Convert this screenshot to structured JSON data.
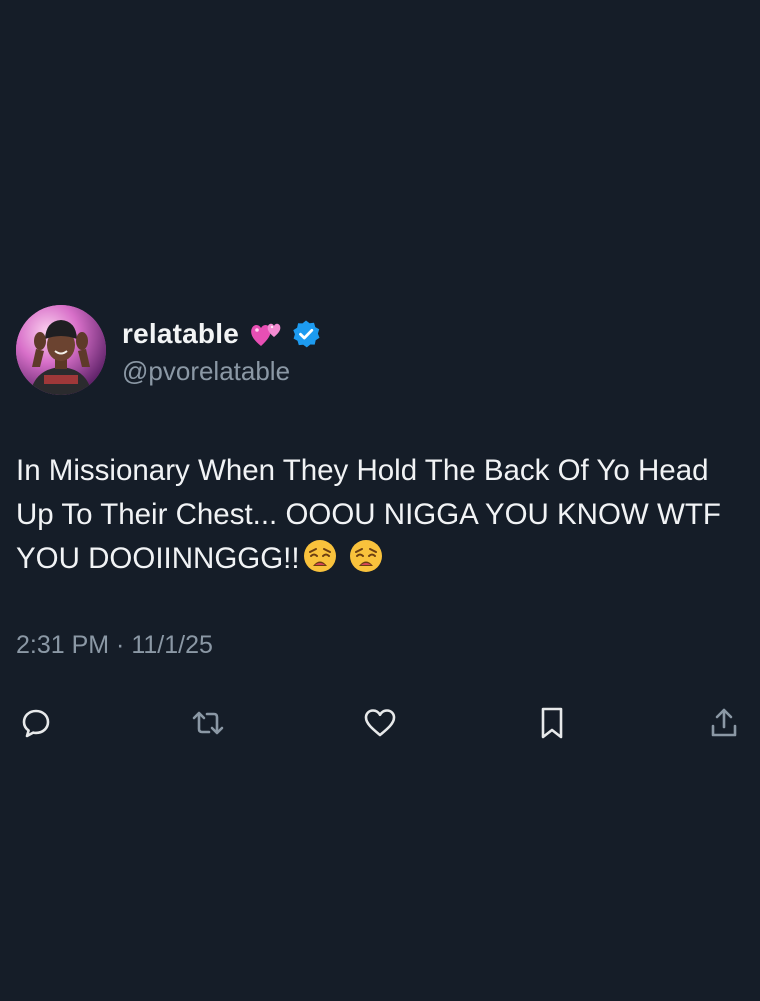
{
  "tweet": {
    "display_name": "relatable",
    "handle": "@pvorelatable",
    "name_emoji": "revolving-hearts-emoji",
    "verified_badge": "blue-verified-check-icon",
    "text": "In Missionary When They Hold The Back Of Yo Head Up To Their Chest... OOOU NIGGA YOU KNOW WTF YOU DOOIINNGGG!!",
    "text_emojis": [
      "weary-face-emoji",
      "weary-face-emoji"
    ],
    "timestamp": "2:31 PM · 11/1/25"
  },
  "actions": [
    {
      "name": "reply",
      "icon": "reply-icon"
    },
    {
      "name": "repost",
      "icon": "repost-icon"
    },
    {
      "name": "like",
      "icon": "heart-icon"
    },
    {
      "name": "bookmark",
      "icon": "bookmark-icon"
    },
    {
      "name": "share",
      "icon": "share-icon"
    }
  ],
  "colors": {
    "background": "#151d28",
    "text_primary": "#f1f3f5",
    "text_secondary": "#8b98a5",
    "verified_blue": "#1d9bf0"
  }
}
